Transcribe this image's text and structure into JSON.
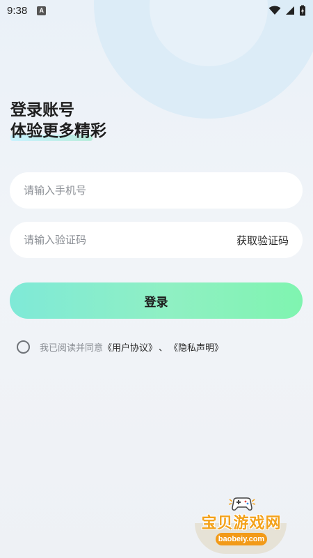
{
  "status_bar": {
    "time": "9:38",
    "notification_icon": "a-letter-icon",
    "icons": [
      "wifi-icon",
      "signal-icon",
      "battery-charging-icon"
    ]
  },
  "headline": {
    "line1": "登录账号",
    "line2": "体验更多精彩"
  },
  "phone_input": {
    "placeholder": "请输入手机号",
    "value": ""
  },
  "code_input": {
    "placeholder": "请输入验证码",
    "value": "",
    "get_code_label": "获取验证码"
  },
  "login_button": {
    "label": "登录"
  },
  "agreement": {
    "checked": false,
    "prefix": "我已阅读并同意",
    "user_agreement": "《用户协议》",
    "separator": "、",
    "privacy": "《隐私声明》"
  },
  "watermark": {
    "title": "宝贝游戏网",
    "url": "baobeiy.com"
  },
  "colors": {
    "accent_start": "#7fe9d7",
    "accent_end": "#7ff4b0",
    "watermark": "#f3a21b"
  }
}
